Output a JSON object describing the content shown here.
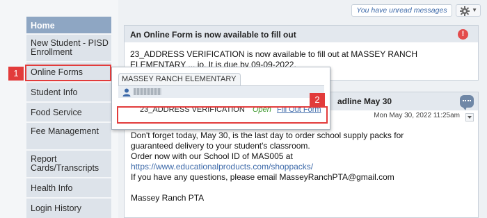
{
  "sidebar": {
    "items": [
      {
        "label": "Home"
      },
      {
        "label": "New Student - PISD Enrollment"
      },
      {
        "label": "Online Forms"
      },
      {
        "label": "Student Info"
      },
      {
        "label": "Food Service"
      },
      {
        "label": "Fee Management"
      },
      {
        "label": "Report Cards/Transcripts"
      },
      {
        "label": "Health Info"
      },
      {
        "label": "Login History"
      }
    ]
  },
  "topbar": {
    "unread_messages": "You have unread messages"
  },
  "notice": {
    "title": "An Online Form is now available to fill out",
    "body": "23_ADDRESS VERIFICATION is now available to fill out at MASSEY RANCH ELEMENTARY ... io.  It is due by 09-09-2022."
  },
  "post": {
    "title_partial": "adline May 30",
    "date": "Mon May 30, 2022 11:25am",
    "lines": [
      "Don't forget today, May 30, is the last day to order school supply packs for",
      "guaranteed delivery to your student's classroom.",
      "Order now with our School ID of MAS005 at"
    ],
    "link": "https://www.educationalproducts.com/shoppacks/",
    "contact_line": "If you have any questions, please email MasseyRanchPTA@gmail.com",
    "signature": "Massey Ranch PTA"
  },
  "popup": {
    "school_tab": "MASSEY RANCH ELEMENTARY",
    "form_name": "23_ADDRESS VERIFICATION",
    "form_status": "Open",
    "form_action": "Fill Out Form"
  },
  "annotations": {
    "step1": "1",
    "step2": "2"
  },
  "colors": {
    "accent": "#8ea6c3",
    "annotation_red": "#e23b3b",
    "link_blue": "#3b68a8",
    "status_green": "#3f9a2e"
  }
}
